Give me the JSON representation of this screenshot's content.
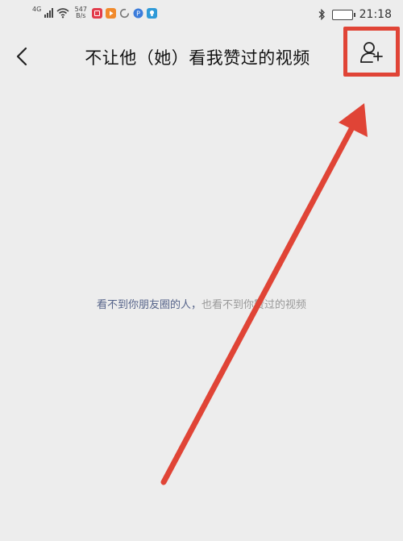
{
  "status_bar": {
    "network_type": "4G",
    "speed_value": "547",
    "speed_unit": "B/s",
    "battery_level": 78,
    "battery_label": "78",
    "time": "21:18",
    "app_icons": [
      "red-app-icon",
      "orange-play-icon",
      "circle-outline-icon",
      "blue-circle-icon",
      "lightbulb-icon"
    ],
    "app_icon_colors": [
      "#e23b4b",
      "#f18a2c",
      "#888888",
      "#3b7cdb",
      "#2f9ad8"
    ]
  },
  "header": {
    "title": "不让他（她）看我赞过的视频",
    "back_icon": "chevron-left-icon",
    "add_user_icon": "add-user-icon"
  },
  "content": {
    "empty_text_primary": "看不到你朋友圈的人，",
    "empty_text_secondary": "也看不到你赞过的视频"
  },
  "annotation": {
    "highlight_color": "#e04436",
    "arrow_color": "#e04436"
  }
}
